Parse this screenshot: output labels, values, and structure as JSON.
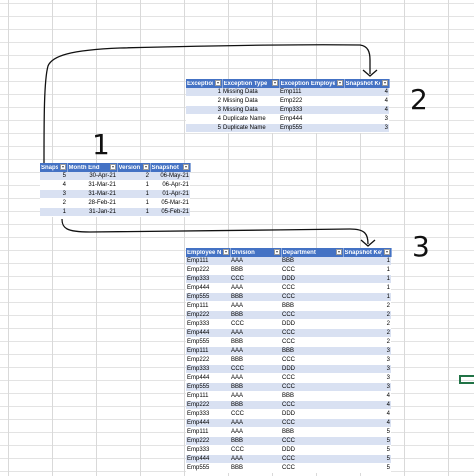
{
  "exception_table": {
    "headers": [
      "Exception ID",
      "Exception Type",
      "Exception Employee",
      "Snapshot Key"
    ],
    "rows": [
      [
        "1",
        "Missing Data",
        "Emp111",
        "4"
      ],
      [
        "2",
        "Missing Data",
        "Emp222",
        "4"
      ],
      [
        "3",
        "Missing Data",
        "Emp333",
        "4"
      ],
      [
        "4",
        "Duplicate Name",
        "Emp444",
        "3"
      ],
      [
        "5",
        "Duplicate Name",
        "Emp555",
        "3"
      ]
    ]
  },
  "snapshot_table": {
    "headers": [
      "Snapshot",
      "Month End",
      "Version",
      "Snapshot"
    ],
    "rows": [
      [
        "5",
        "30-Apr-21",
        "2",
        "06-May-21"
      ],
      [
        "4",
        "31-Mar-21",
        "1",
        "06-Apr-21"
      ],
      [
        "3",
        "31-Mar-21",
        "1",
        "01-Apr-21"
      ],
      [
        "2",
        "28-Feb-21",
        "1",
        "05-Mar-21"
      ],
      [
        "1",
        "31-Jan-21",
        "1",
        "05-Feb-21"
      ]
    ]
  },
  "employee_table": {
    "headers": [
      "Employee N",
      "Division",
      "Department",
      "Snapshot Key"
    ],
    "rows": [
      [
        "Emp111",
        "AAA",
        "BBB",
        "1"
      ],
      [
        "Emp222",
        "BBB",
        "CCC",
        "1"
      ],
      [
        "Emp333",
        "CCC",
        "DDD",
        "1"
      ],
      [
        "Emp444",
        "AAA",
        "CCC",
        "1"
      ],
      [
        "Emp555",
        "BBB",
        "CCC",
        "1"
      ],
      [
        "Emp111",
        "AAA",
        "BBB",
        "2"
      ],
      [
        "Emp222",
        "BBB",
        "CCC",
        "2"
      ],
      [
        "Emp333",
        "CCC",
        "DDD",
        "2"
      ],
      [
        "Emp444",
        "AAA",
        "CCC",
        "2"
      ],
      [
        "Emp555",
        "BBB",
        "CCC",
        "2"
      ],
      [
        "Emp111",
        "AAA",
        "BBB",
        "3"
      ],
      [
        "Emp222",
        "BBB",
        "CCC",
        "3"
      ],
      [
        "Emp333",
        "CCC",
        "DDD",
        "3"
      ],
      [
        "Emp444",
        "AAA",
        "CCC",
        "3"
      ],
      [
        "Emp555",
        "BBB",
        "CCC",
        "3"
      ],
      [
        "Emp111",
        "AAA",
        "BBB",
        "4"
      ],
      [
        "Emp222",
        "BBB",
        "CCC",
        "4"
      ],
      [
        "Emp333",
        "CCC",
        "DDD",
        "4"
      ],
      [
        "Emp444",
        "AAA",
        "CCC",
        "4"
      ],
      [
        "Emp111",
        "AAA",
        "BBB",
        "5"
      ],
      [
        "Emp222",
        "BBB",
        "CCC",
        "5"
      ],
      [
        "Emp333",
        "CCC",
        "DDD",
        "5"
      ],
      [
        "Emp444",
        "AAA",
        "CCC",
        "5"
      ],
      [
        "Emp555",
        "BBB",
        "CCC",
        "5"
      ]
    ]
  },
  "annotations": {
    "label_1": "1",
    "label_2": "2",
    "label_3": "3"
  },
  "colors": {
    "header_blue": "#4472c4",
    "band_light_blue": "#d9e1f2",
    "excel_green": "#217346"
  }
}
